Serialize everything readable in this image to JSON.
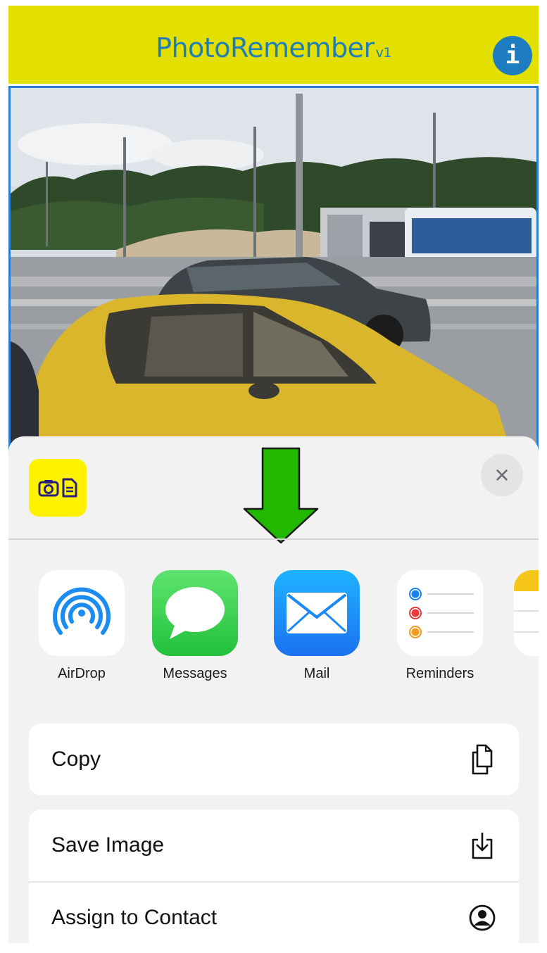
{
  "header": {
    "title": "PhotoRemember",
    "version": "v1",
    "info_label": "i"
  },
  "photo": {
    "description_icon": "photo-icon"
  },
  "share_sheet": {
    "close_label": "×",
    "share_targets": [
      {
        "label": "AirDrop",
        "icon": "airdrop-icon"
      },
      {
        "label": "Messages",
        "icon": "messages-icon"
      },
      {
        "label": "Mail",
        "icon": "mail-icon"
      },
      {
        "label": "Reminders",
        "icon": "reminders-icon"
      }
    ],
    "actions": [
      {
        "label": "Copy",
        "icon": "copy-icon"
      },
      {
        "label": "Save Image",
        "icon": "save-image-icon"
      },
      {
        "label": "Assign to Contact",
        "icon": "contact-icon"
      }
    ]
  },
  "colors": {
    "header_bg": "#e3e000",
    "title": "#1f7fb5",
    "info_button": "#1e7dc1",
    "arrow": "#22b800",
    "sheet_bg": "#f2f2f2"
  }
}
